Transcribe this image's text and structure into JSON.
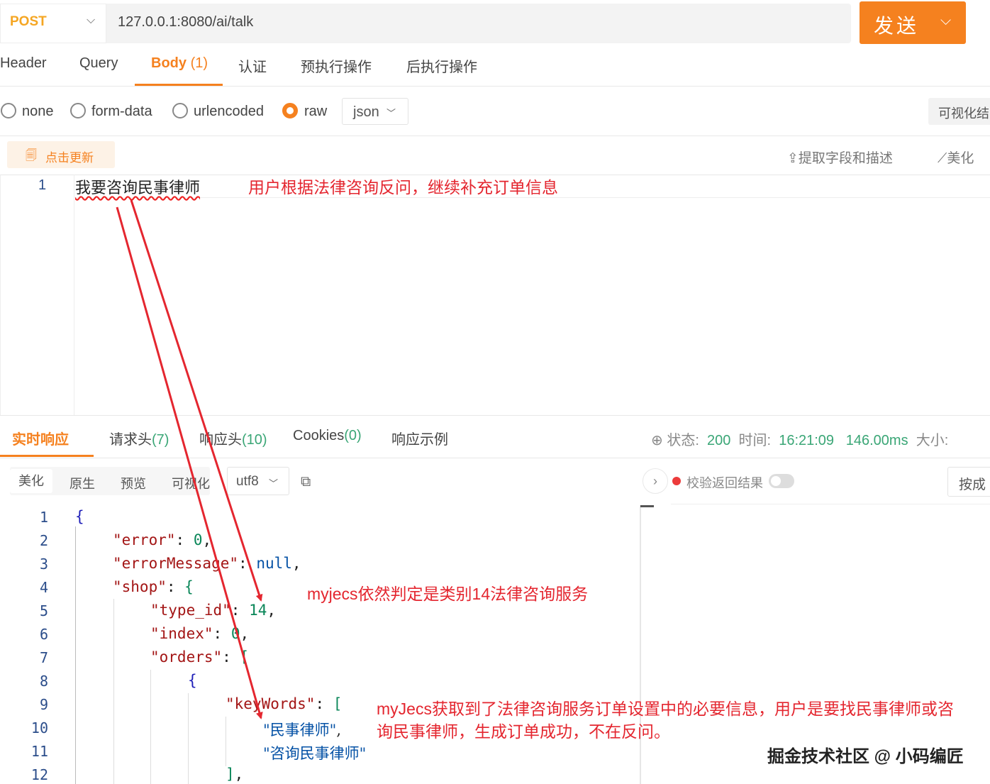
{
  "request": {
    "method": "POST",
    "url": "127.0.0.1:8080/ai/talk",
    "send_label": "发送",
    "tabs": [
      {
        "label": "Header"
      },
      {
        "label": "Query"
      },
      {
        "label": "Body",
        "count": "(1)"
      },
      {
        "label": "认证"
      },
      {
        "label": "预执行操作"
      },
      {
        "label": "后执行操作"
      }
    ],
    "body_types": [
      "none",
      "form-data",
      "urlencoded",
      "raw"
    ],
    "selected_body_type": "raw",
    "format": "json",
    "visualize_label": "可视化结",
    "refresh_label": "点击更新",
    "extract_label": "提取字段和描述",
    "beautify_label": "美化",
    "editor": {
      "line_number": "1",
      "text": "我要咨询民事律师"
    }
  },
  "annotations": {
    "first": "用户根据法律咨询反问，继续补充订单信息",
    "second": "myjecs依然判定是类别14法律咨询服务",
    "third_line1": "myJecs获取到了法律咨询服务订单设置中的必要信息，用户是要找民事律师或咨",
    "third_line2": "询民事律师，生成订单成功，不在反问。"
  },
  "response": {
    "tabs": [
      {
        "label": "实时响应",
        "count": ""
      },
      {
        "label": "请求头",
        "count": "(7)"
      },
      {
        "label": "响应头",
        "count": "(10)"
      },
      {
        "label": "Cookies",
        "count": "(0)"
      },
      {
        "label": "响应示例",
        "count": ""
      }
    ],
    "status_label": "状态:",
    "status_value": "200",
    "time_label": "时间:",
    "time_value": "16:21:09",
    "duration": "146.00ms",
    "size_label": "大小:",
    "view_modes": [
      "美化",
      "原生",
      "预览",
      "可视化"
    ],
    "active_view": "美化",
    "encoding": "utf8",
    "validate_label": "校验返回结果",
    "right_button": "按成",
    "code_lines": [
      {
        "no": "1"
      },
      {
        "no": "2"
      },
      {
        "no": "3"
      },
      {
        "no": "4"
      },
      {
        "no": "5"
      },
      {
        "no": "6"
      },
      {
        "no": "7"
      },
      {
        "no": "8"
      },
      {
        "no": "9"
      },
      {
        "no": "10"
      },
      {
        "no": "11"
      },
      {
        "no": "12"
      }
    ],
    "json": {
      "brace_open": "{",
      "error_key": "\"error\"",
      "error_val": "0",
      "errorMessage_key": "\"errorMessage\"",
      "errorMessage_val": "null",
      "shop_key": "\"shop\"",
      "type_id_key": "\"type_id\"",
      "type_id_val": "14",
      "index_key": "\"index\"",
      "index_val": "0",
      "orders_key": "\"orders\"",
      "keyWords_key": "\"keyWords\"",
      "kw1": "\"民事律师\"",
      "kw2": "\"咨询民事律师\""
    }
  },
  "watermark": "掘金技术社区 @ 小码编匠",
  "colors": {
    "accent": "#f5811f",
    "method": "#f5a623",
    "annotation": "#e4262f",
    "success": "#3aa676"
  }
}
